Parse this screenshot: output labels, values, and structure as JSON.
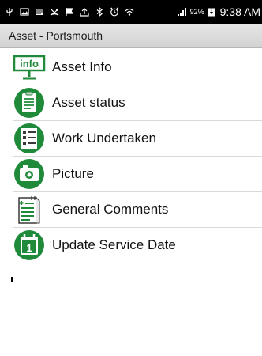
{
  "status_bar": {
    "battery_percent": "92%",
    "time": "9:38 AM"
  },
  "title_bar": {
    "title": "Asset - Portsmouth"
  },
  "menu": {
    "items": [
      {
        "label": "Asset Info",
        "icon": "info-icon",
        "icon_text": "info"
      },
      {
        "label": "Asset status",
        "icon": "clipboard-icon"
      },
      {
        "label": "Work Undertaken",
        "icon": "checklist-icon"
      },
      {
        "label": "Picture",
        "icon": "camera-icon"
      },
      {
        "label": "General Comments",
        "icon": "notepad-icon"
      },
      {
        "label": "Update Service Date",
        "icon": "calendar-icon",
        "icon_text": "1"
      }
    ]
  },
  "colors": {
    "accent_green": "#1f8a3a",
    "status_bar_bg": "#000000",
    "title_bar_bg": "#dcdcdc",
    "divider": "#d9d9d9"
  }
}
